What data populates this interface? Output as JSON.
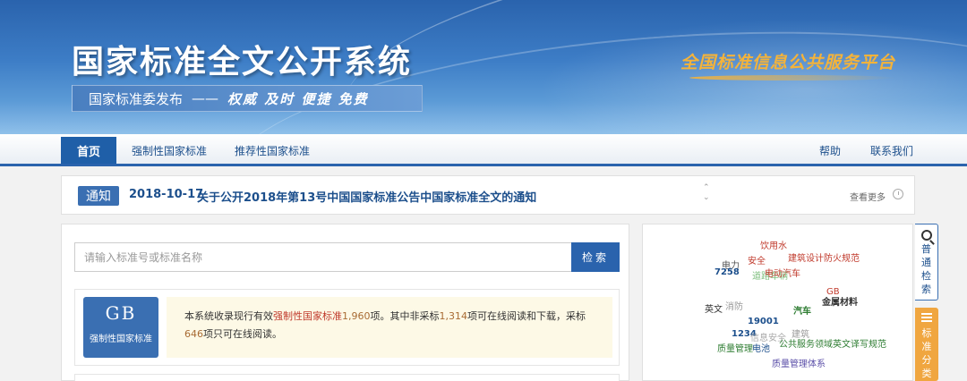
{
  "header": {
    "site_title": "国家标准全文公开系统",
    "publisher": "国家标准委发布",
    "dash": "——",
    "motto": "权威 及时 便捷 免费",
    "platform": "全国标准信息公共服务平台"
  },
  "nav": {
    "items": [
      {
        "label": "首页",
        "active": true
      },
      {
        "label": "强制性国家标准",
        "active": false
      },
      {
        "label": "推荐性国家标准",
        "active": false
      }
    ],
    "right": [
      {
        "label": "帮助"
      },
      {
        "label": "联系我们"
      }
    ]
  },
  "notice": {
    "tag": "通知",
    "date": "2018-10-17",
    "title": "关于公开2018年第13号中国国家标准公告中国家标准全文的通知",
    "more": "查看更多"
  },
  "search": {
    "placeholder": "请输入标准号或标准名称",
    "button": "检索"
  },
  "gb": {
    "code": "GB",
    "label": "强制性国家标准",
    "info_prefix": "本系统收录现行有效",
    "info_link": "强制性国家标准",
    "count_total": "1,960",
    "info_mid1": "项。其中非采标",
    "count_nonadopted": "1,314",
    "info_mid2": "项可在线阅读和下载，采标",
    "count_adopted": "646",
    "info_suffix": "项只可在线阅读。"
  },
  "tag_cloud": [
    {
      "text": "饮用水",
      "color": "#c0392b"
    },
    {
      "text": "电力",
      "color": "#555555"
    },
    {
      "text": "安全",
      "color": "#c0392b"
    },
    {
      "text": "建筑设计防火规范",
      "color": "#c0392b"
    },
    {
      "text": "7258",
      "color": "#1c4f8c"
    },
    {
      "text": "道路车辆",
      "color": "#7fbf7f"
    },
    {
      "text": "电动汽车",
      "color": "#c0392b"
    },
    {
      "text": "GB",
      "color": "#c0392b"
    },
    {
      "text": "金属材料",
      "color": "#333333"
    },
    {
      "text": "英文",
      "color": "#333333"
    },
    {
      "text": "消防",
      "color": "#999999"
    },
    {
      "text": "汽车",
      "color": "#2e7d32"
    },
    {
      "text": "19001",
      "color": "#1c4f8c"
    },
    {
      "text": "1234",
      "color": "#1c4f8c"
    },
    {
      "text": "信息安全",
      "color": "#aaaaaa"
    },
    {
      "text": "建筑",
      "color": "#999999"
    },
    {
      "text": "质量管理",
      "color": "#2e7d32"
    },
    {
      "text": "电池",
      "color": "#1c4f8c"
    },
    {
      "text": "公共服务领域英文译写规范",
      "color": "#2e7d32"
    },
    {
      "text": "质量管理体系",
      "color": "#5b4fa8"
    }
  ],
  "side": {
    "search_tab": [
      "普",
      "通",
      "检",
      "索"
    ],
    "classify_tab": [
      "标",
      "准",
      "分",
      "类"
    ]
  }
}
